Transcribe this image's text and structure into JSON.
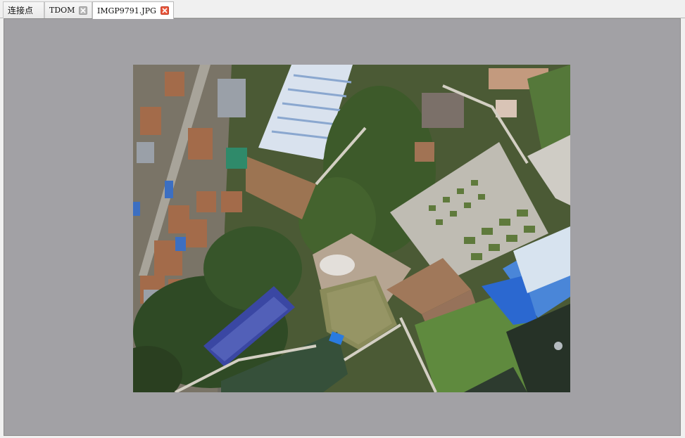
{
  "tabs": [
    {
      "label": "连接点",
      "closable": false,
      "active": false
    },
    {
      "label": "TDOM",
      "closable": true,
      "close_style": "gray",
      "active": false
    },
    {
      "label": "IMGP9791.JPG",
      "closable": true,
      "close_style": "red",
      "active": true
    }
  ],
  "viewer": {
    "background_color": "#a2a1a5",
    "image_description_icon": "aerial-photo"
  },
  "colors": {
    "tab_active": "#ffffff",
    "close_active": "#e8553a",
    "close_inactive": "#b8b8b8"
  }
}
